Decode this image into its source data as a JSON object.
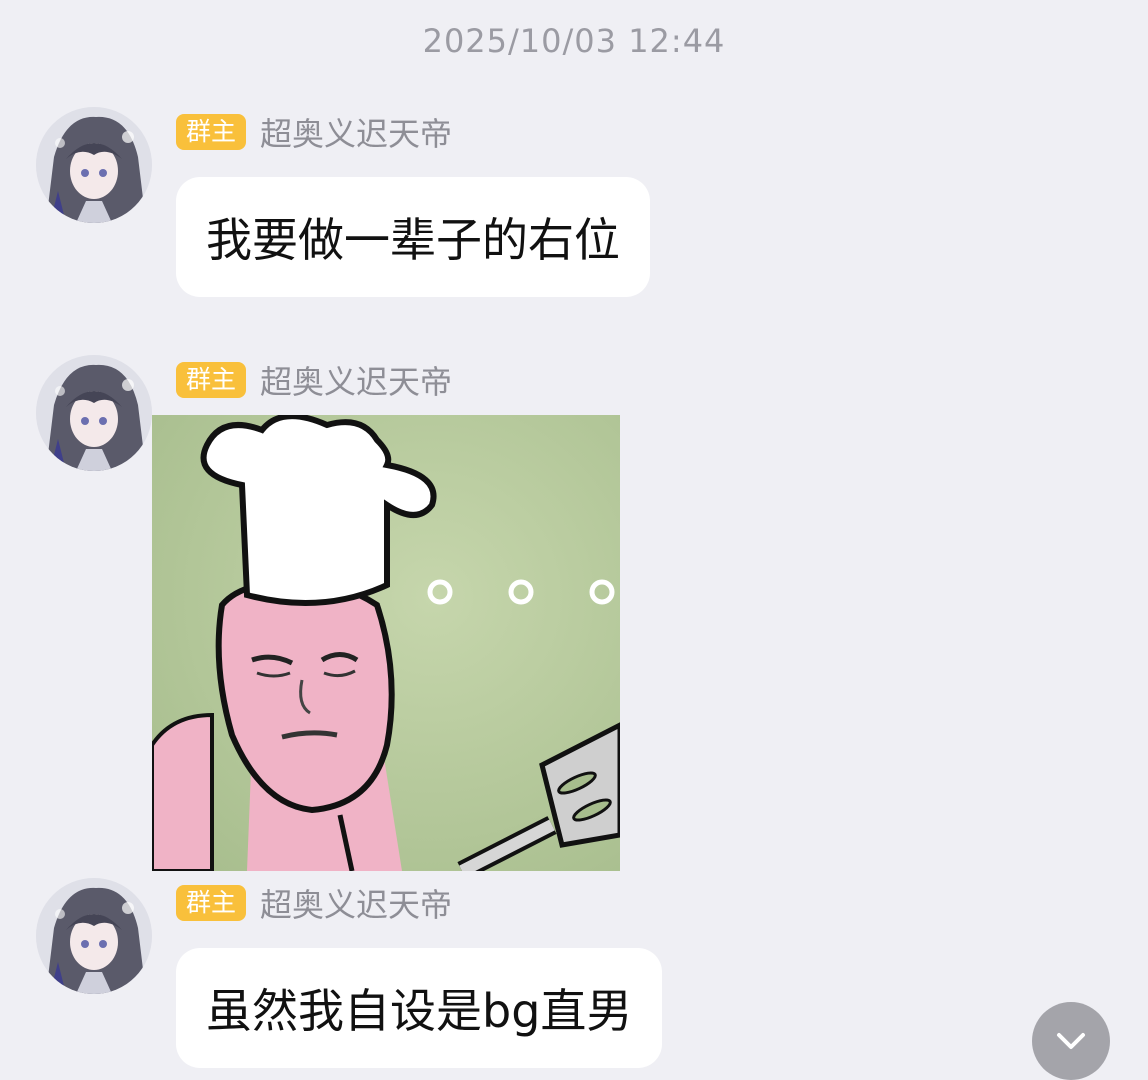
{
  "chat": {
    "timestamp": "2025/10/03 12:44",
    "messages": [
      {
        "sender": {
          "role_badge": "群主",
          "name": "超奥义迟天帝"
        },
        "text": "我要做一辈子的右位"
      },
      {
        "sender": {
          "role_badge": "群主",
          "name": "超奥义迟天帝"
        },
        "sticker": {
          "caption": "○○○",
          "icon": "chef-meme-sticker"
        }
      },
      {
        "sender": {
          "role_badge": "群主",
          "name": "超奥义迟天帝"
        },
        "text": "虽然我自设是bg直男"
      }
    ]
  },
  "controls": {
    "scroll_down_icon": "chevron-down-icon"
  },
  "colors": {
    "background": "#efeff4",
    "bubble": "#ffffff",
    "badge": "#f9c03b",
    "name_text": "#8e8e96",
    "timestamp_text": "#9b9ba3",
    "scroll_button": "#a4a4aa"
  }
}
